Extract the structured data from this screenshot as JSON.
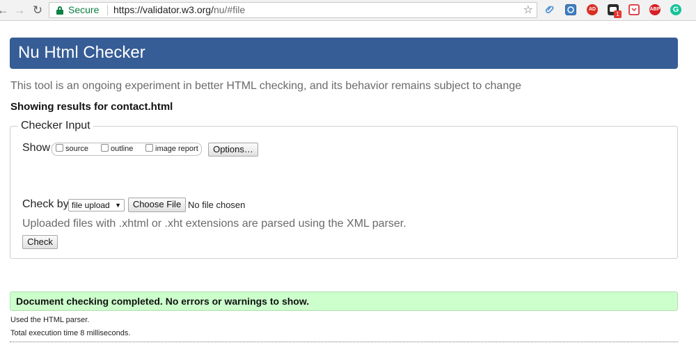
{
  "browser": {
    "secure_label": "Secure",
    "url_host": "https://validator.w3.org/",
    "url_path": "nu/#file",
    "extensions": [
      {
        "icon": "paperclip-icon",
        "label": "",
        "color": "#4a8fd6"
      },
      {
        "icon": "sync-icon",
        "label": "",
        "color": "#3f7fc4"
      },
      {
        "icon": "ad-icon",
        "label": "AD",
        "color": "#d93025"
      },
      {
        "icon": "chat-icon",
        "label": "",
        "color": "#2b2b2b"
      },
      {
        "icon": "pocket-icon",
        "label": "",
        "color": "#e0464f"
      },
      {
        "icon": "abp-icon",
        "label": "ABP",
        "color": "#d81f26"
      },
      {
        "icon": "grammarly-icon",
        "label": "G",
        "color": "#15c39a"
      }
    ],
    "badge_count": "1"
  },
  "header": {
    "title": "Nu Html Checker",
    "intro": "This tool is an ongoing experiment in better HTML checking, and its behavior remains subject to change"
  },
  "results_heading": "Showing results for contact.html",
  "checker_input": {
    "legend": "Checker Input",
    "show_label": "Show",
    "show_options": [
      "source",
      "outline",
      "image report"
    ],
    "options_button": "Options…",
    "check_by_label": "Check by",
    "check_by_value": "file upload",
    "choose_file_button": "Choose File",
    "no_file_text": "No file chosen",
    "hint": "Uploaded files with .xhtml or .xht extensions are parsed using the XML parser.",
    "check_button": "Check"
  },
  "result": {
    "message": "Document checking completed. No errors or warnings to show.",
    "parser": "Used the HTML parser.",
    "time": "Total execution time 8 milliseconds."
  }
}
